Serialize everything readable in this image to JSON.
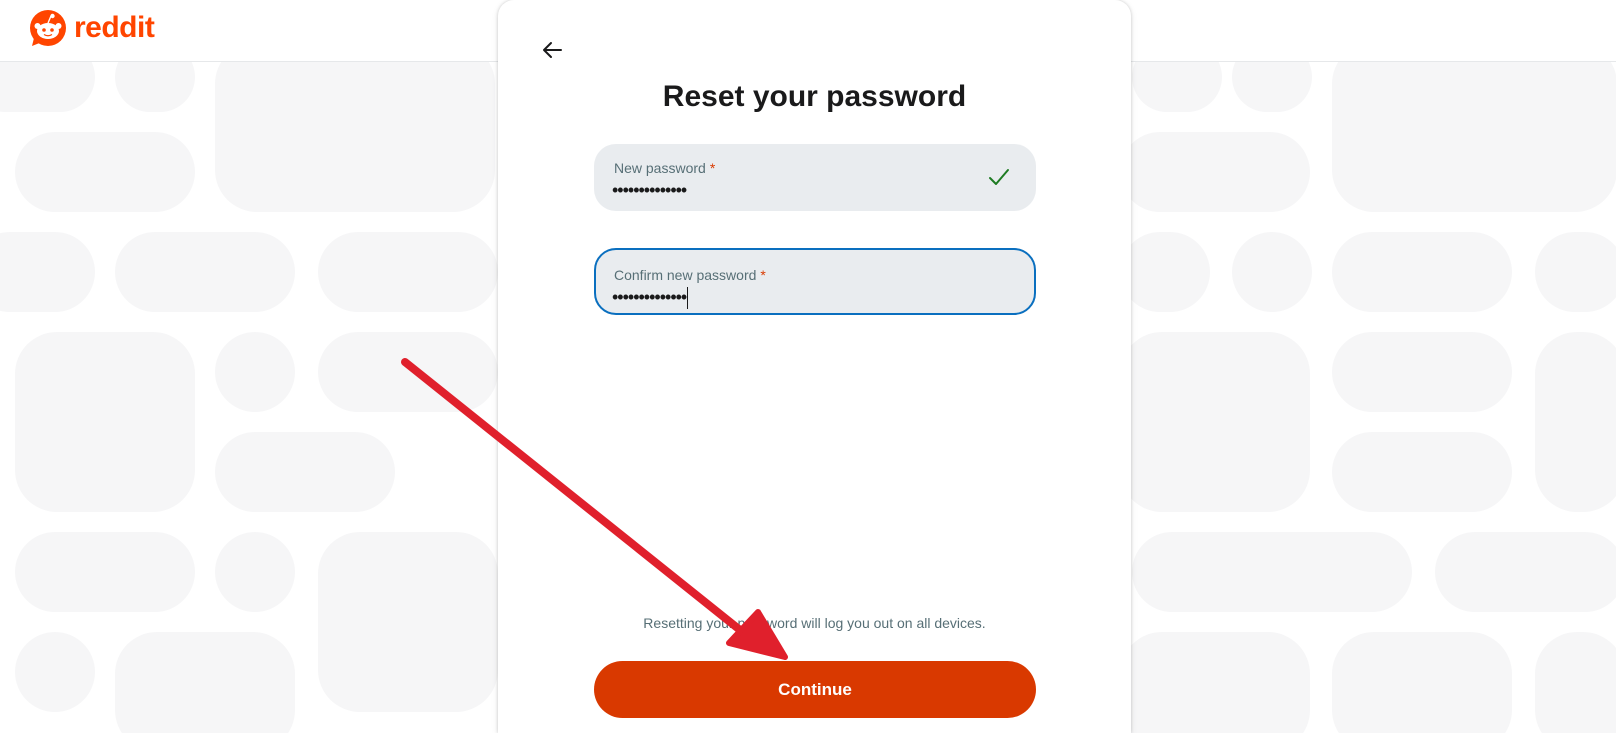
{
  "header": {
    "logo_text": "reddit"
  },
  "modal": {
    "title": "Reset your password",
    "new_password": {
      "label": "New password",
      "required_mark": "*",
      "value": "••••••••••••••",
      "status": "valid"
    },
    "confirm_password": {
      "label": "Confirm new password",
      "required_mark": "*",
      "value": "••••••••••••••",
      "focused": true
    },
    "notice": "Resetting your password will log you out on all devices.",
    "continue_label": "Continue"
  },
  "colors": {
    "brand": "#ff4500",
    "button": "#d93900",
    "focus_border": "#0a6fbf",
    "valid_check": "#1e7b22",
    "annotation_arrow": "#e0202c"
  }
}
